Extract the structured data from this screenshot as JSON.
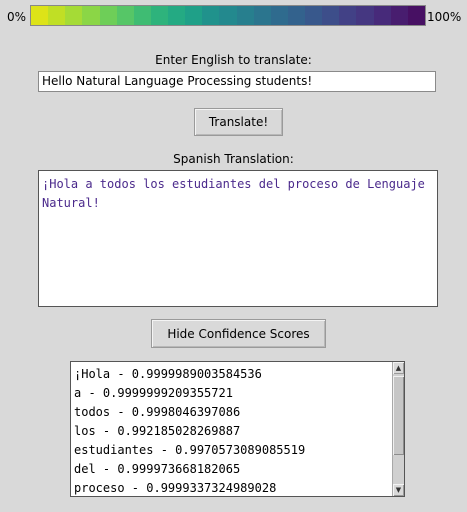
{
  "scale": {
    "min_label": "0%",
    "max_label": "100%",
    "colors": [
      "#dde318",
      "#c0df25",
      "#a5db36",
      "#8bd646",
      "#6ece58",
      "#56c667",
      "#3fbc73",
      "#2eb37c",
      "#24aa83",
      "#1fa088",
      "#20928c",
      "#23898e",
      "#277f8e",
      "#2b758e",
      "#2f6b8e",
      "#33628d",
      "#38588c",
      "#3d4e8a",
      "#424186",
      "#453781",
      "#472a7a",
      "#481d6f",
      "#471063"
    ]
  },
  "input": {
    "label": "Enter English to translate:",
    "value": "Hello Natural Language Processing students!"
  },
  "translate_button": {
    "label": "Translate!"
  },
  "output": {
    "label": "Spanish Translation:",
    "text": "¡Hola a todos los estudiantes del proceso de Lenguaje Natural!",
    "text_color": "#4b2a8c"
  },
  "confidence_button": {
    "label": "Hide Confidence Scores"
  },
  "scores": [
    "¡Hola - 0.9999989003584536",
    "a - 0.9999999209355721",
    "todos - 0.9998046397086",
    "los - 0.992185028269887",
    "estudiantes - 0.9970573089085519",
    "del - 0.999973668182065",
    "proceso - 0.9999337324989028"
  ]
}
